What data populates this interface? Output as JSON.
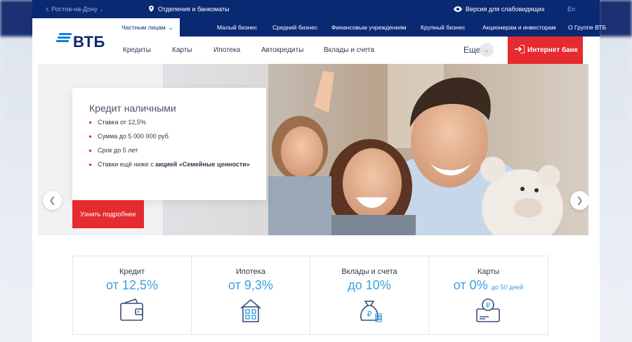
{
  "topbar": {
    "city": "г. Ростов-на-Дону",
    "branches": "Отделения и банкоматы",
    "vision": "Версия для слабовидящих",
    "lang": "En"
  },
  "segments": [
    {
      "label": "Частным лицам"
    },
    {
      "label": "Малый бизнес"
    },
    {
      "label": "Средний бизнес"
    },
    {
      "label": "Финансовым учреждениям"
    },
    {
      "label": "Крупный бизнес"
    },
    {
      "label": "Акционерам и инвесторам"
    },
    {
      "label": "О Группе ВТБ"
    }
  ],
  "logo": {
    "text": "ВТБ"
  },
  "mainnav": {
    "items": [
      "Кредиты",
      "Карты",
      "Ипотека",
      "Автокредиты",
      "Вклады и счета"
    ],
    "more": "Еще",
    "ibank": "Интернет банк"
  },
  "hero": {
    "title": "Кредит наличными",
    "bullets": [
      "Ставка от 12,5%",
      "Сумма до 5 000 000 руб.",
      "Срок до 5 лет"
    ],
    "bullet4_prefix": "Ставки ещё ниже с ",
    "bullet4_bold": "акцией «Семейные ценности»",
    "cta": "Узнать подробнее",
    "slides_total": 6,
    "active_slide": 1
  },
  "products": [
    {
      "name": "Кредит",
      "rate": "от 12,5%",
      "note": "",
      "icon": "wallet-icon"
    },
    {
      "name": "Ипотека",
      "rate": "от 9,3%",
      "note": "",
      "icon": "house-icon"
    },
    {
      "name": "Вклады и счета",
      "rate": "до 10%",
      "note": "",
      "icon": "money-bag-icon"
    },
    {
      "name": "Карты",
      "rate": "от 0%",
      "note": "до 50 дней",
      "icon": "card-icon"
    }
  ],
  "colors": {
    "brand_navy": "#0a2973",
    "brand_blue": "#0d7ee3",
    "accent_red": "#e52b2f",
    "rate_blue": "#3aa0e0"
  }
}
